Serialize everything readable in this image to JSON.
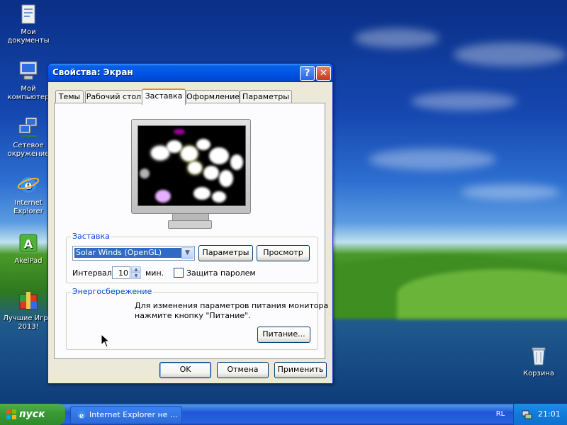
{
  "desktop": {
    "icons": [
      {
        "label": "Мои документы",
        "icon": "my-documents-icon"
      },
      {
        "label": "Мой компьютер",
        "icon": "my-computer-icon"
      },
      {
        "label": "Сетевое окружение",
        "icon": "network-icon"
      },
      {
        "label": "Internet Explorer",
        "icon": "internet-explorer-icon"
      },
      {
        "label": "AkelPad",
        "icon": "akelpad-icon"
      },
      {
        "label": "Лучшие Игры 2013!",
        "icon": "games-icon"
      },
      {
        "label": "Корзина",
        "icon": "recycle-bin-icon"
      }
    ]
  },
  "window": {
    "title": "Свойства: Экран",
    "help_glyph": "?",
    "close_glyph": "✕",
    "tabs": [
      {
        "label": "Темы",
        "active": false
      },
      {
        "label": "Рабочий стол",
        "active": false
      },
      {
        "label": "Заставка",
        "active": true
      },
      {
        "label": "Оформление",
        "active": false
      },
      {
        "label": "Параметры",
        "active": false
      }
    ],
    "screensaver": {
      "group_title": "Заставка",
      "selected": "Solar Winds (OpenGL)",
      "settings_label": "Параметры",
      "preview_label": "Просмотр",
      "interval_label": "Интервал:",
      "interval_value": "10",
      "minutes_label": "мин.",
      "password_label": "Защита паролем",
      "password_checked": false
    },
    "power": {
      "group_title": "Энергосбережение",
      "description_line1": "Для изменения параметров питания монитора",
      "description_line2": "нажмите кнопку \"Питание\".",
      "power_button_label": "Питание..."
    },
    "buttons": {
      "ok": "OK",
      "cancel": "Отмена",
      "apply": "Применить"
    }
  },
  "taskbar": {
    "start_label": "пуск",
    "task_label": "Internet Explorer не ...",
    "language": "RL",
    "clock": "21:01"
  },
  "colors": {
    "title_blue": "#0055e5",
    "group_title": "#0046d5",
    "tab_highlight": "#e68b2c",
    "start_green": "#3a9b37",
    "selection": "#316ac5"
  }
}
